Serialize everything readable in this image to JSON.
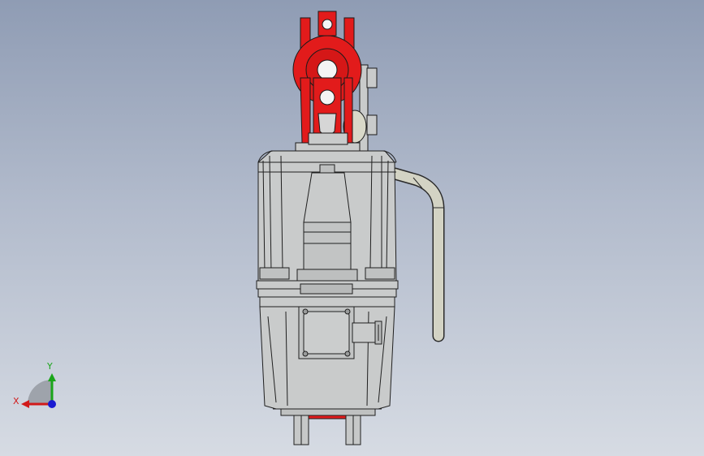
{
  "viewport": {
    "background_top": "#8f9cb4",
    "background_bottom": "#d6dbe3"
  },
  "model": {
    "body_color": "#c9cbcb",
    "edge_color": "#1f1f1f",
    "accent_color": "#e21b1b",
    "hose_color": "#d3d3c4"
  },
  "triad": {
    "x_label": "X",
    "y_label": "Y",
    "x_color": "#d11a1a",
    "y_color": "#1aa51a",
    "z_color": "#1a1ad1"
  }
}
